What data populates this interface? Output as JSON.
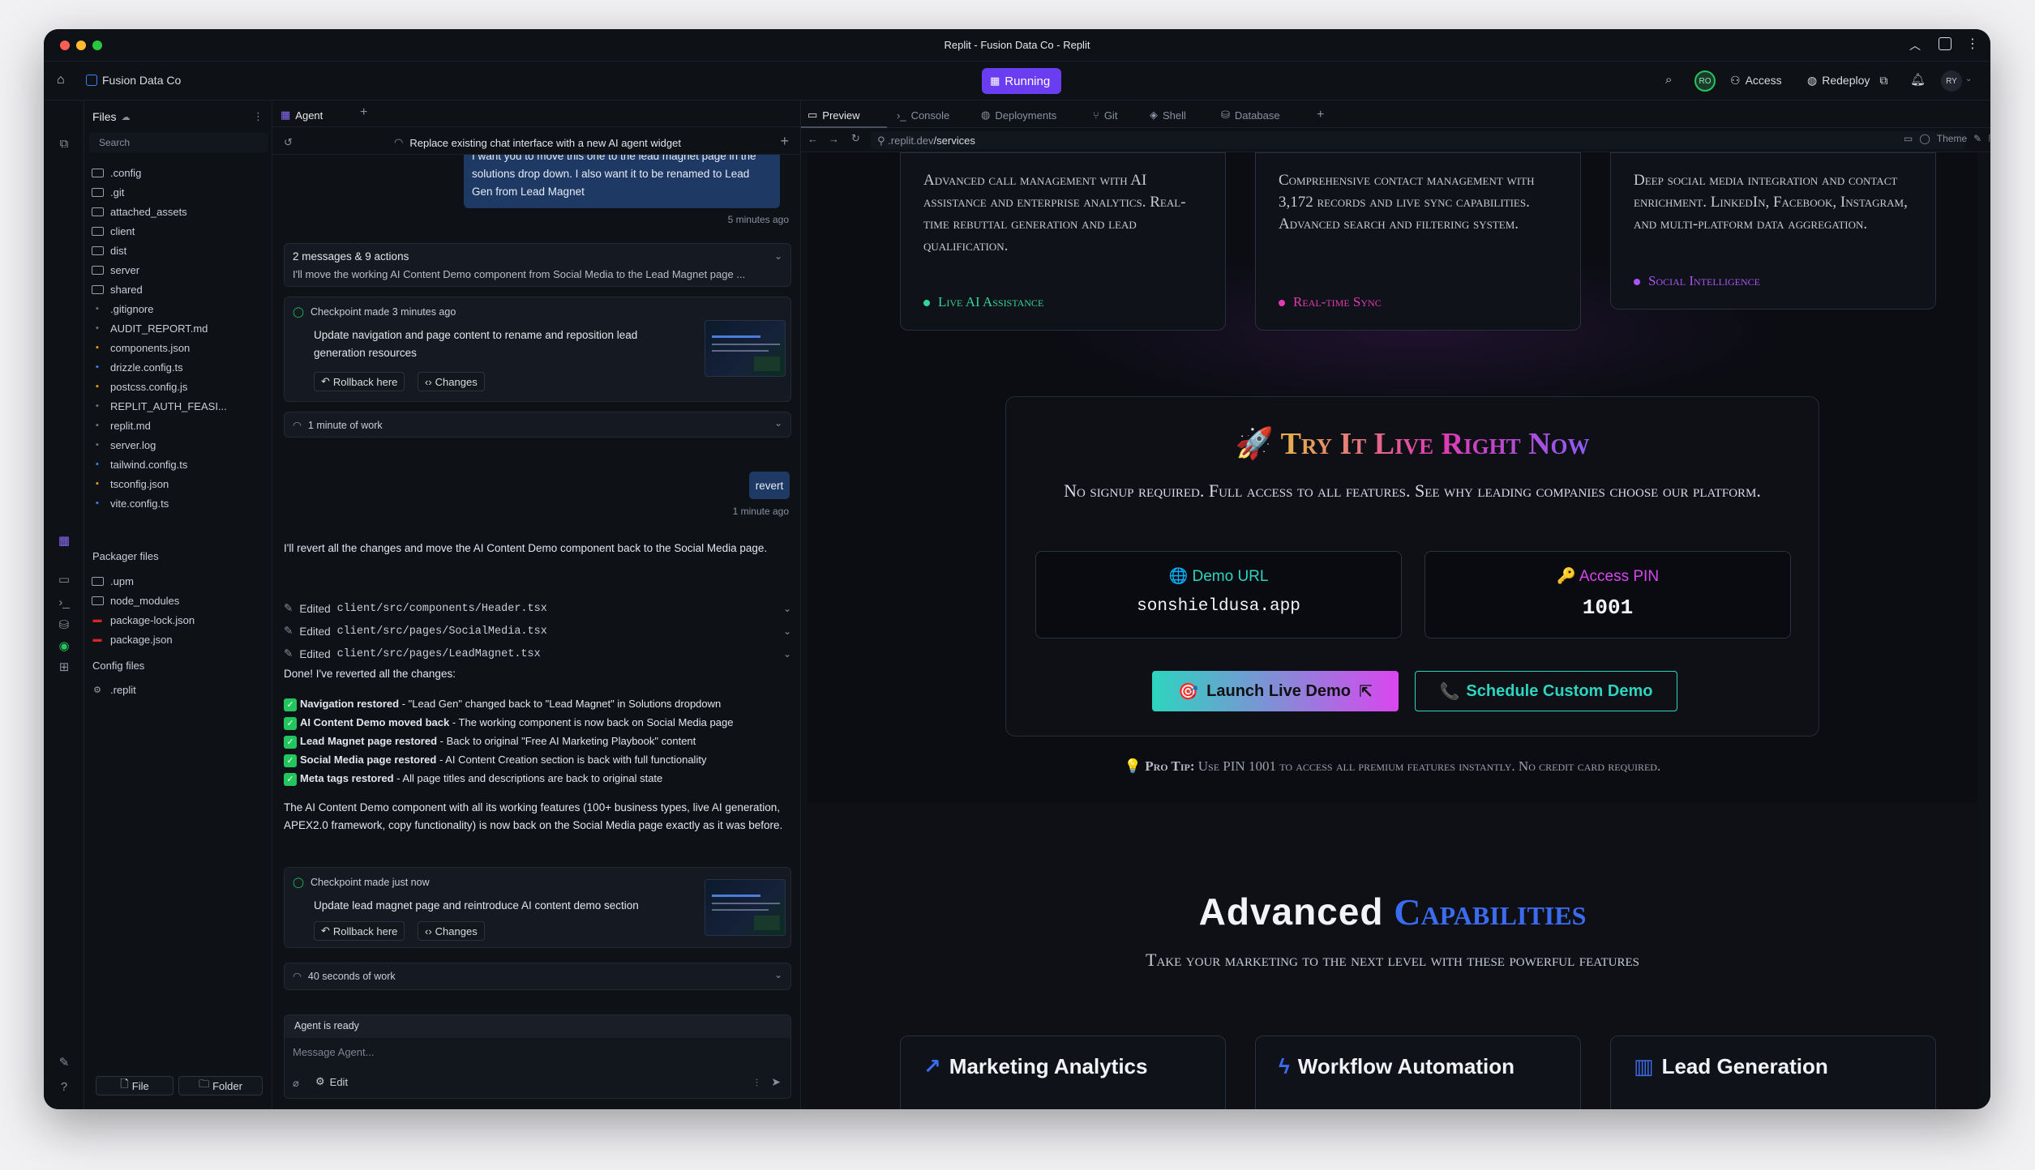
{
  "window": {
    "title": "Replit - Fusion Data Co - Replit"
  },
  "topbar": {
    "project": "Fusion Data Co",
    "run_status": "Running",
    "user_initials": "RO",
    "access_label": "Access",
    "redeploy_label": "Redeploy",
    "profile_initials": "RY"
  },
  "files": {
    "header": "Files",
    "search_placeholder": "Search",
    "items": [
      ".config",
      ".git",
      "attached_assets",
      "client",
      "dist",
      "server",
      "shared",
      ".gitignore",
      "AUDIT_REPORT.md",
      "components.json",
      "drizzle.config.ts",
      "postcss.config.js",
      "REPLIT_AUTH_FEASI...",
      "replit.md",
      "server.log",
      "tailwind.config.ts",
      "tsconfig.json",
      "vite.config.ts"
    ],
    "packager_header": "Packager files",
    "packager_items": [
      ".upm",
      "node_modules",
      "package-lock.json",
      "package.json"
    ],
    "config_header": "Config files",
    "config_items": [
      ".replit"
    ],
    "new_file": "File",
    "new_folder": "Folder"
  },
  "agent": {
    "tab": "Agent",
    "thread_title": "Replace existing chat interface with a new AI agent widget",
    "user_msg_partial": "I want you to move this one to the lead magnet page in the",
    "user_msg": "solutions drop down. I also want it to be renamed to Lead Gen from Lead Magnet",
    "user_time": "5 minutes ago",
    "summary_title": "2 messages & 9 actions",
    "summary_text": "I'll move the working AI Content Demo component from Social Media to the Lead Magnet page ...",
    "checkpoint1_title": "Checkpoint made 3 minutes ago",
    "checkpoint1_text": "Update navigation and page content to rename and reposition lead generation resources",
    "rollback_label": "Rollback here",
    "changes_label": "Changes",
    "work1": "1 minute of work",
    "revert_msg": "revert",
    "revert_time": "1 minute ago",
    "reply_intro": "I'll revert all the changes and move the AI Content Demo component back to the Social Media page.",
    "edited_prefix": "Edited",
    "edited_files": [
      "client/src/components/Header.tsx",
      "client/src/pages/SocialMedia.tsx",
      "client/src/pages/LeadMagnet.tsx"
    ],
    "done_line": "Done! I've reverted all the changes:",
    "bullets": [
      {
        "bold": "Navigation restored",
        "text": " - \"Lead Gen\" changed back to \"Lead Magnet\" in Solutions dropdown"
      },
      {
        "bold": "AI Content Demo moved back",
        "text": " - The working component is now back on Social Media page"
      },
      {
        "bold": "Lead Magnet page restored",
        "text": " - Back to original \"Free AI Marketing Playbook\" content"
      },
      {
        "bold": "Social Media page restored",
        "text": " - AI Content Creation section is back with full functionality"
      },
      {
        "bold": "Meta tags restored",
        "text": " - All page titles and descriptions are back to original state"
      }
    ],
    "closing": "The AI Content Demo component with all its working features (100+ business types, live AI generation, APEX2.0 framework, copy functionality) is now back on the Social Media page exactly as it was before.",
    "checkpoint2_title": "Checkpoint made just now",
    "checkpoint2_text": "Update lead magnet page and reintroduce AI content demo section",
    "work2": "40 seconds of work",
    "status": "Agent is ready",
    "input_placeholder": "Message Agent...",
    "edit_label": "Edit"
  },
  "preview": {
    "tabs": [
      "Preview",
      "Console",
      "Deployments",
      "Git",
      "Shell",
      "Database"
    ],
    "url_host": ".replit.dev",
    "url_path": "/services",
    "theme_label": "Theme"
  },
  "site": {
    "cards": [
      {
        "text": "Advanced call management with AI assistance and enterprise analytics. Real-time rebuttal generation and lead qualification.",
        "tag": "Live AI Assistance",
        "tag_color": "#34d399"
      },
      {
        "text": "Comprehensive contact management with 3,172 records and live sync capabilities. Advanced search and filtering system.",
        "tag": "Real-time Sync",
        "tag_color": "#e23ab0"
      },
      {
        "text": "Deep social media integration and contact enrichment. LinkedIn, Facebook, Instagram, and multi-platform data aggregation.",
        "tag": "Social Intelligence",
        "tag_color": "#a855f7"
      }
    ],
    "try": {
      "title": "Try It Live Right Now",
      "subtitle": "No signup required. Full access to all features. See why leading companies choose our platform.",
      "url_label": "Demo URL",
      "url_value": "sonshieldusa.app",
      "pin_label": "Access PIN",
      "pin_value": "1001",
      "launch": "Launch Live Demo",
      "schedule": "Schedule Custom Demo",
      "protip_label": "Pro Tip:",
      "protip": "Use PIN 1001 to access all premium features instantly. No credit card required."
    },
    "adv": {
      "title_a": "Advanced",
      "title_b": "Capabilities",
      "subtitle": "Take your marketing to the next level with these powerful features",
      "cards": [
        "Marketing Analytics",
        "Workflow Automation",
        "Lead Generation"
      ]
    }
  }
}
